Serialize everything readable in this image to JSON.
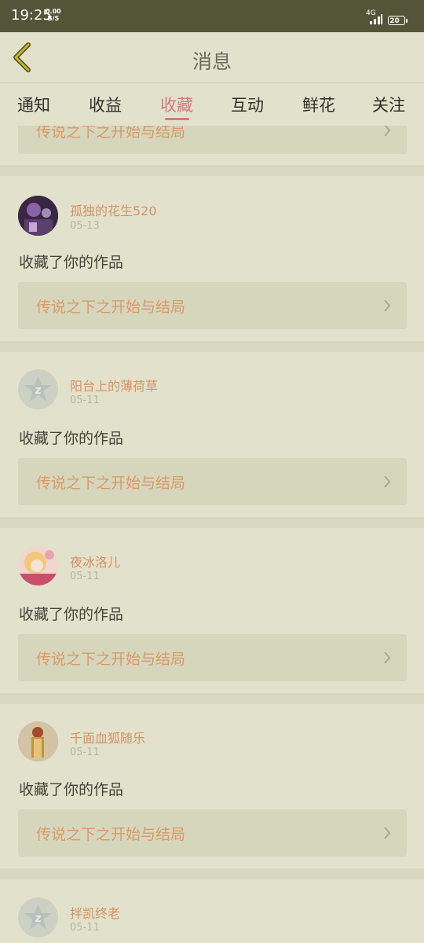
{
  "status_bar": {
    "time": "19:25",
    "speed_value": "0.00",
    "speed_unit": "B/S",
    "network": "4G",
    "battery": "20"
  },
  "header": {
    "title": "消息",
    "back_icon": "chevron-left-icon"
  },
  "tabs": [
    {
      "label": "通知"
    },
    {
      "label": "收益"
    },
    {
      "label": "收藏",
      "active": true
    },
    {
      "label": "互动"
    },
    {
      "label": "鲜花"
    },
    {
      "label": "关注"
    }
  ],
  "colors": {
    "background": "#e2e2cc",
    "accent": "#d7777d",
    "username": "#d88f62",
    "work_title": "#db9866"
  },
  "list": {
    "partial_top": {
      "work_title": "传说之下之开始与结局"
    },
    "items": [
      {
        "username": "孤独的花生520",
        "date": "05-13",
        "action": "收藏了你的作品",
        "work_title": "传说之下之开始与结局",
        "avatar": "purple-photo"
      },
      {
        "username": "阳台上的薄荷草",
        "date": "05-11",
        "action": "收藏了你的作品",
        "work_title": "传说之下之开始与结局",
        "avatar": "default-logo"
      },
      {
        "username": "夜冰洛儿",
        "date": "05-11",
        "action": "收藏了你的作品",
        "work_title": "传说之下之开始与结局",
        "avatar": "anime-photo"
      },
      {
        "username": "千面血狐随乐",
        "date": "05-11",
        "action": "收藏了你的作品",
        "work_title": "传说之下之开始与结局",
        "avatar": "figure-photo"
      },
      {
        "username": "拌凯终老",
        "date": "05-11",
        "action": "",
        "work_title": "",
        "avatar": "default-logo"
      }
    ]
  }
}
